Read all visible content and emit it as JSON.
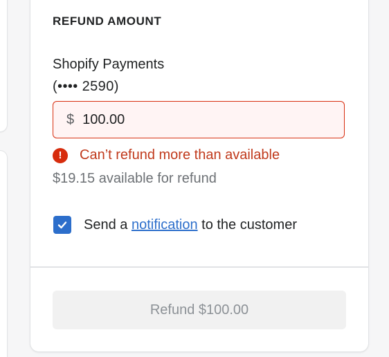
{
  "refund": {
    "section_title": "REFUND AMOUNT",
    "method_name": "Shopify Payments",
    "method_card": "(•••• 2590)",
    "currency_symbol": "$",
    "amount_value": "100.00",
    "error_icon_glyph": "!",
    "error_message": "Can’t refund more than available",
    "available_text": "$19.15 available for refund",
    "notify_prefix": "Send a ",
    "notify_link": "notification",
    "notify_suffix": " to the customer",
    "notify_checked": true,
    "button_label": "Refund $100.00",
    "button_disabled": true
  },
  "icons": {
    "error": "exclamation-circle-icon",
    "checkbox": "checkmark-icon"
  },
  "colors": {
    "error": "#d72c0d",
    "error_field_bg": "#fff4f4",
    "accent": "#2c6ecb",
    "disabled_button_bg": "#f1f1f1",
    "disabled_button_text": "#8c9196"
  }
}
